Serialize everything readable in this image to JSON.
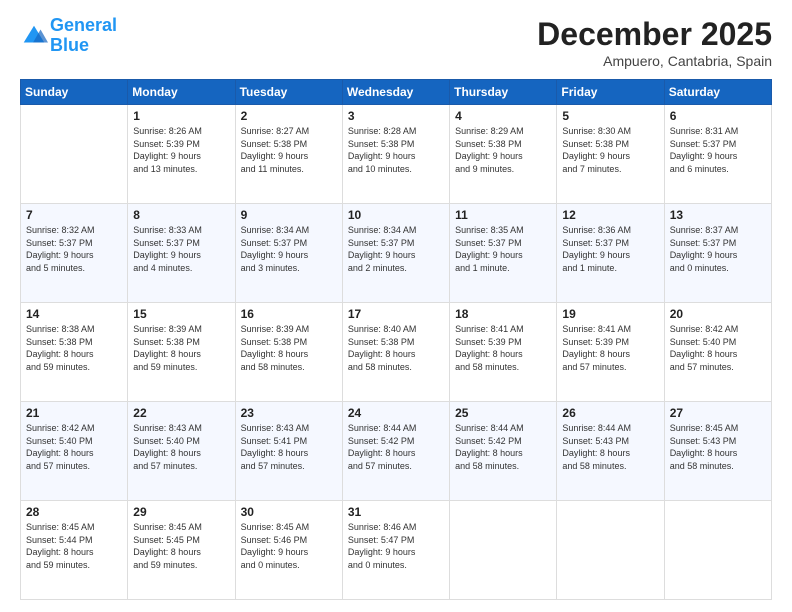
{
  "logo": {
    "line1": "General",
    "line2": "Blue"
  },
  "header": {
    "month": "December 2025",
    "location": "Ampuero, Cantabria, Spain"
  },
  "days_header": [
    "Sunday",
    "Monday",
    "Tuesday",
    "Wednesday",
    "Thursday",
    "Friday",
    "Saturday"
  ],
  "weeks": [
    [
      {
        "num": "",
        "info": ""
      },
      {
        "num": "1",
        "info": "Sunrise: 8:26 AM\nSunset: 5:39 PM\nDaylight: 9 hours\nand 13 minutes."
      },
      {
        "num": "2",
        "info": "Sunrise: 8:27 AM\nSunset: 5:38 PM\nDaylight: 9 hours\nand 11 minutes."
      },
      {
        "num": "3",
        "info": "Sunrise: 8:28 AM\nSunset: 5:38 PM\nDaylight: 9 hours\nand 10 minutes."
      },
      {
        "num": "4",
        "info": "Sunrise: 8:29 AM\nSunset: 5:38 PM\nDaylight: 9 hours\nand 9 minutes."
      },
      {
        "num": "5",
        "info": "Sunrise: 8:30 AM\nSunset: 5:38 PM\nDaylight: 9 hours\nand 7 minutes."
      },
      {
        "num": "6",
        "info": "Sunrise: 8:31 AM\nSunset: 5:37 PM\nDaylight: 9 hours\nand 6 minutes."
      }
    ],
    [
      {
        "num": "7",
        "info": "Sunrise: 8:32 AM\nSunset: 5:37 PM\nDaylight: 9 hours\nand 5 minutes."
      },
      {
        "num": "8",
        "info": "Sunrise: 8:33 AM\nSunset: 5:37 PM\nDaylight: 9 hours\nand 4 minutes."
      },
      {
        "num": "9",
        "info": "Sunrise: 8:34 AM\nSunset: 5:37 PM\nDaylight: 9 hours\nand 3 minutes."
      },
      {
        "num": "10",
        "info": "Sunrise: 8:34 AM\nSunset: 5:37 PM\nDaylight: 9 hours\nand 2 minutes."
      },
      {
        "num": "11",
        "info": "Sunrise: 8:35 AM\nSunset: 5:37 PM\nDaylight: 9 hours\nand 1 minute."
      },
      {
        "num": "12",
        "info": "Sunrise: 8:36 AM\nSunset: 5:37 PM\nDaylight: 9 hours\nand 1 minute."
      },
      {
        "num": "13",
        "info": "Sunrise: 8:37 AM\nSunset: 5:37 PM\nDaylight: 9 hours\nand 0 minutes."
      }
    ],
    [
      {
        "num": "14",
        "info": "Sunrise: 8:38 AM\nSunset: 5:38 PM\nDaylight: 8 hours\nand 59 minutes."
      },
      {
        "num": "15",
        "info": "Sunrise: 8:39 AM\nSunset: 5:38 PM\nDaylight: 8 hours\nand 59 minutes."
      },
      {
        "num": "16",
        "info": "Sunrise: 8:39 AM\nSunset: 5:38 PM\nDaylight: 8 hours\nand 58 minutes."
      },
      {
        "num": "17",
        "info": "Sunrise: 8:40 AM\nSunset: 5:38 PM\nDaylight: 8 hours\nand 58 minutes."
      },
      {
        "num": "18",
        "info": "Sunrise: 8:41 AM\nSunset: 5:39 PM\nDaylight: 8 hours\nand 58 minutes."
      },
      {
        "num": "19",
        "info": "Sunrise: 8:41 AM\nSunset: 5:39 PM\nDaylight: 8 hours\nand 57 minutes."
      },
      {
        "num": "20",
        "info": "Sunrise: 8:42 AM\nSunset: 5:40 PM\nDaylight: 8 hours\nand 57 minutes."
      }
    ],
    [
      {
        "num": "21",
        "info": "Sunrise: 8:42 AM\nSunset: 5:40 PM\nDaylight: 8 hours\nand 57 minutes."
      },
      {
        "num": "22",
        "info": "Sunrise: 8:43 AM\nSunset: 5:40 PM\nDaylight: 8 hours\nand 57 minutes."
      },
      {
        "num": "23",
        "info": "Sunrise: 8:43 AM\nSunset: 5:41 PM\nDaylight: 8 hours\nand 57 minutes."
      },
      {
        "num": "24",
        "info": "Sunrise: 8:44 AM\nSunset: 5:42 PM\nDaylight: 8 hours\nand 57 minutes."
      },
      {
        "num": "25",
        "info": "Sunrise: 8:44 AM\nSunset: 5:42 PM\nDaylight: 8 hours\nand 58 minutes."
      },
      {
        "num": "26",
        "info": "Sunrise: 8:44 AM\nSunset: 5:43 PM\nDaylight: 8 hours\nand 58 minutes."
      },
      {
        "num": "27",
        "info": "Sunrise: 8:45 AM\nSunset: 5:43 PM\nDaylight: 8 hours\nand 58 minutes."
      }
    ],
    [
      {
        "num": "28",
        "info": "Sunrise: 8:45 AM\nSunset: 5:44 PM\nDaylight: 8 hours\nand 59 minutes."
      },
      {
        "num": "29",
        "info": "Sunrise: 8:45 AM\nSunset: 5:45 PM\nDaylight: 8 hours\nand 59 minutes."
      },
      {
        "num": "30",
        "info": "Sunrise: 8:45 AM\nSunset: 5:46 PM\nDaylight: 9 hours\nand 0 minutes."
      },
      {
        "num": "31",
        "info": "Sunrise: 8:46 AM\nSunset: 5:47 PM\nDaylight: 9 hours\nand 0 minutes."
      },
      {
        "num": "",
        "info": ""
      },
      {
        "num": "",
        "info": ""
      },
      {
        "num": "",
        "info": ""
      }
    ]
  ]
}
